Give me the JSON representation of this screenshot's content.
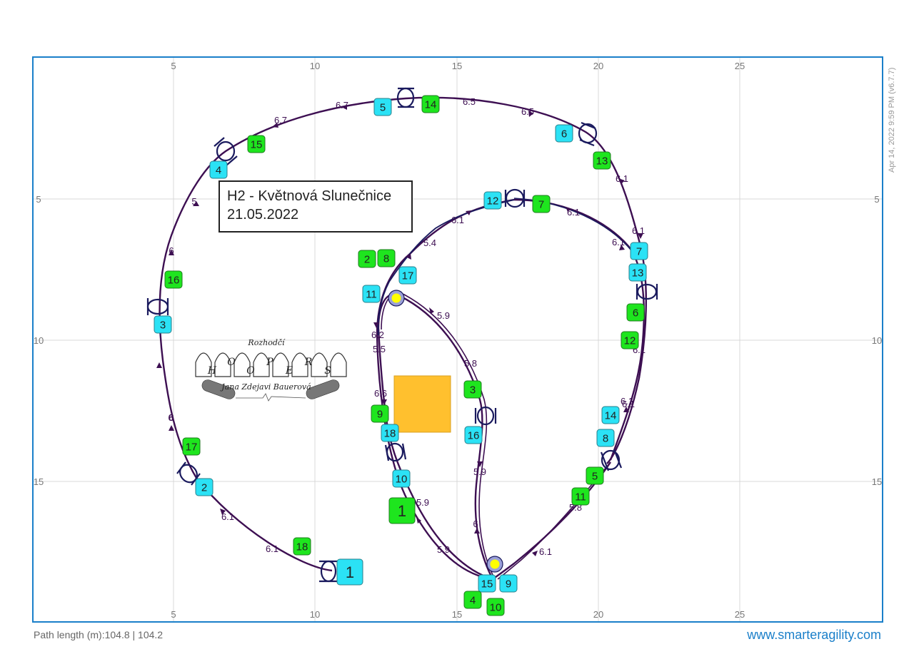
{
  "title": {
    "line1": "H2 - Květnová Slunečnice",
    "line2": "21.05.2022"
  },
  "footer": {
    "path_length": "Path length (m):104.8 | 104.2",
    "website": "www.smarteragility.com"
  },
  "stamp": "Apr 14, 2022 9:59 PM  (v6.7.7)",
  "axis": {
    "x_ticks": [
      "5",
      "10",
      "15",
      "20",
      "25"
    ],
    "y_ticks": [
      "5",
      "10",
      "15"
    ]
  },
  "judge_logo": {
    "title": "Rozhodčí",
    "letters": [
      "H",
      "O",
      "O",
      "P",
      "E",
      "R",
      "S"
    ],
    "name": "Jana Zdejavi Bauerová"
  },
  "colors": {
    "border": "#1a7fc9",
    "path": "#3d0f52",
    "hoop": "#1a1a5e",
    "cyan": "#2be2f5",
    "green": "#1ee51e",
    "tunnel": "#ffc02e",
    "start": "#ffff00"
  },
  "cyan_labels": [
    {
      "text": "1"
    },
    {
      "text": "2"
    },
    {
      "text": "3"
    },
    {
      "text": "4"
    },
    {
      "text": "5"
    },
    {
      "text": "6"
    },
    {
      "text": "7"
    },
    {
      "text": "8"
    },
    {
      "text": "9"
    },
    {
      "text": "10"
    },
    {
      "text": "11"
    },
    {
      "text": "12"
    },
    {
      "text": "13"
    },
    {
      "text": "14"
    },
    {
      "text": "15"
    },
    {
      "text": "16"
    },
    {
      "text": "17"
    },
    {
      "text": "18"
    }
  ],
  "green_labels": [
    {
      "text": "1"
    },
    {
      "text": "2"
    },
    {
      "text": "3"
    },
    {
      "text": "4"
    },
    {
      "text": "5"
    },
    {
      "text": "6"
    },
    {
      "text": "7"
    },
    {
      "text": "8"
    },
    {
      "text": "9"
    },
    {
      "text": "10"
    },
    {
      "text": "11"
    },
    {
      "text": "12"
    },
    {
      "text": "13"
    },
    {
      "text": "14"
    },
    {
      "text": "15"
    },
    {
      "text": "16"
    },
    {
      "text": "17"
    },
    {
      "text": "18"
    }
  ],
  "distance_labels": [
    "6.7",
    "6.7",
    "6.5",
    "6.5",
    "6.1",
    "6.1",
    "6.1",
    "6.1",
    "6.1",
    "6.1",
    "6.1",
    "5.8",
    "6.1",
    "5",
    "6",
    "6",
    "6",
    "6.1",
    "6.1",
    "5.4",
    "6.1",
    "6.2",
    "5.5",
    "6.6",
    "5.9",
    "5.8",
    "5.9",
    "6",
    "5.9",
    "5.9"
  ]
}
